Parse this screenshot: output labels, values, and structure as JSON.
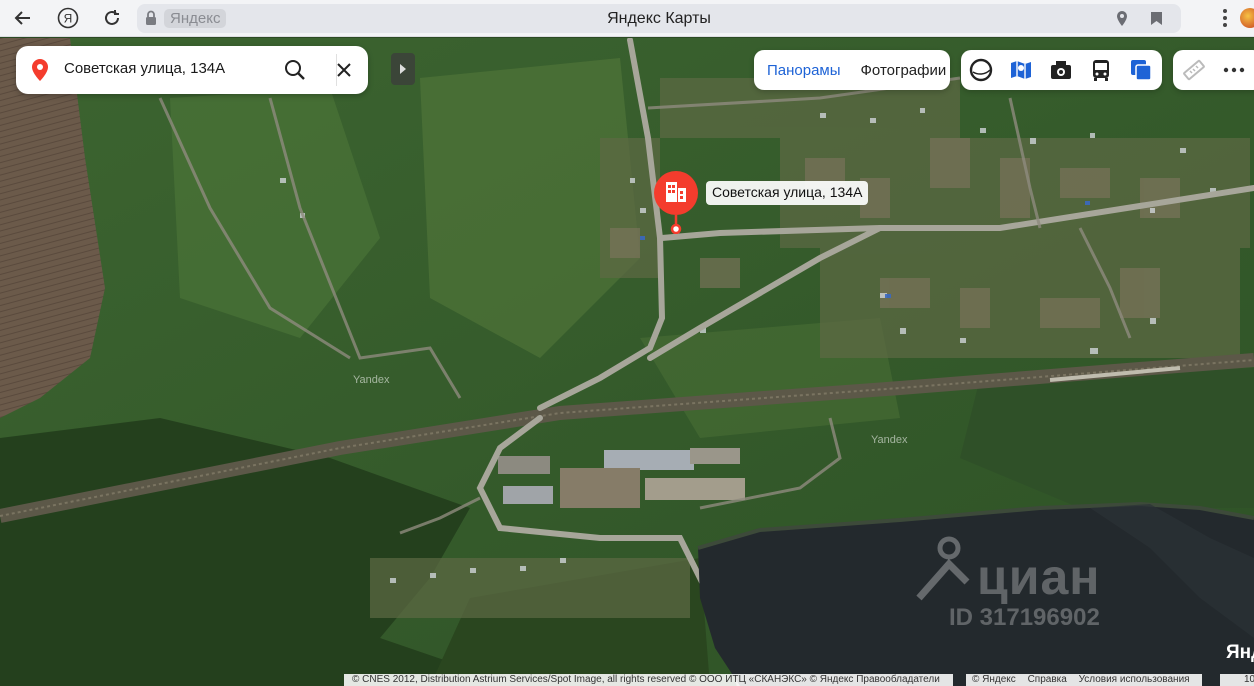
{
  "browser": {
    "host": "Яндекс",
    "tab_title": "Яндекс Карты"
  },
  "search": {
    "query": "Советская улица, 134А"
  },
  "view_tabs": {
    "panoramas": "Панорамы",
    "photos": "Фотографии"
  },
  "layer_buttons": [
    "globe-icon",
    "traffic-icon",
    "camera-icon",
    "bus-icon",
    "layers-icon"
  ],
  "tool_buttons": [
    "ruler-icon",
    "more-icon"
  ],
  "poi": {
    "label": "Советская улица, 134А",
    "color": "#f43c2d"
  },
  "map": {
    "provider_watermark": "Yandex"
  },
  "cian_watermark": {
    "logo": "циан",
    "id": "ID 317196902"
  },
  "footer": {
    "copyright": "© CNES 2012, Distribution Astrium Services/Spot Image, all rights reserved © ООО ИТЦ «СКАНЭКС» © Яндекс   Правообладатели",
    "links": [
      "© Яндекс",
      "Справка",
      "Условия использования"
    ],
    "brand": "Янд",
    "scale": "10"
  },
  "colors": {
    "accent": "#1e63d6",
    "pin": "#f43c2d"
  }
}
